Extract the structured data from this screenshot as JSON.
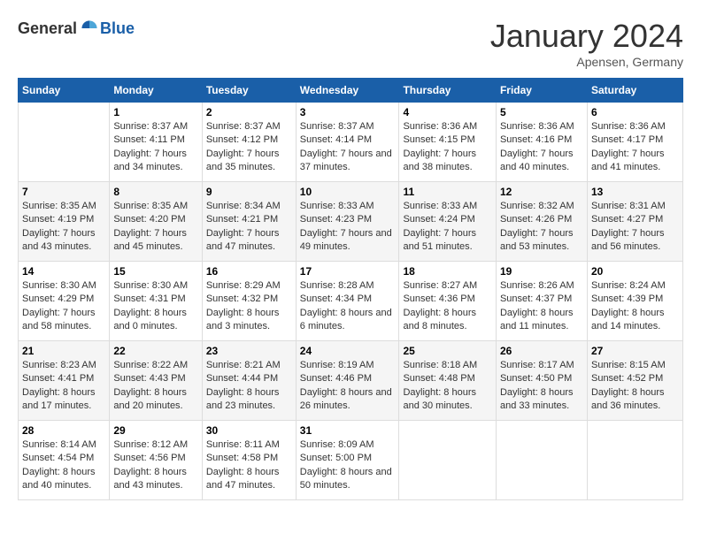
{
  "header": {
    "logo_general": "General",
    "logo_blue": "Blue",
    "month_title": "January 2024",
    "location": "Apensen, Germany"
  },
  "weekdays": [
    "Sunday",
    "Monday",
    "Tuesday",
    "Wednesday",
    "Thursday",
    "Friday",
    "Saturday"
  ],
  "weeks": [
    [
      {
        "day": "",
        "sunrise": "",
        "sunset": "",
        "daylight": ""
      },
      {
        "day": "1",
        "sunrise": "Sunrise: 8:37 AM",
        "sunset": "Sunset: 4:11 PM",
        "daylight": "Daylight: 7 hours and 34 minutes."
      },
      {
        "day": "2",
        "sunrise": "Sunrise: 8:37 AM",
        "sunset": "Sunset: 4:12 PM",
        "daylight": "Daylight: 7 hours and 35 minutes."
      },
      {
        "day": "3",
        "sunrise": "Sunrise: 8:37 AM",
        "sunset": "Sunset: 4:14 PM",
        "daylight": "Daylight: 7 hours and 37 minutes."
      },
      {
        "day": "4",
        "sunrise": "Sunrise: 8:36 AM",
        "sunset": "Sunset: 4:15 PM",
        "daylight": "Daylight: 7 hours and 38 minutes."
      },
      {
        "day": "5",
        "sunrise": "Sunrise: 8:36 AM",
        "sunset": "Sunset: 4:16 PM",
        "daylight": "Daylight: 7 hours and 40 minutes."
      },
      {
        "day": "6",
        "sunrise": "Sunrise: 8:36 AM",
        "sunset": "Sunset: 4:17 PM",
        "daylight": "Daylight: 7 hours and 41 minutes."
      }
    ],
    [
      {
        "day": "7",
        "sunrise": "Sunrise: 8:35 AM",
        "sunset": "Sunset: 4:19 PM",
        "daylight": "Daylight: 7 hours and 43 minutes."
      },
      {
        "day": "8",
        "sunrise": "Sunrise: 8:35 AM",
        "sunset": "Sunset: 4:20 PM",
        "daylight": "Daylight: 7 hours and 45 minutes."
      },
      {
        "day": "9",
        "sunrise": "Sunrise: 8:34 AM",
        "sunset": "Sunset: 4:21 PM",
        "daylight": "Daylight: 7 hours and 47 minutes."
      },
      {
        "day": "10",
        "sunrise": "Sunrise: 8:33 AM",
        "sunset": "Sunset: 4:23 PM",
        "daylight": "Daylight: 7 hours and 49 minutes."
      },
      {
        "day": "11",
        "sunrise": "Sunrise: 8:33 AM",
        "sunset": "Sunset: 4:24 PM",
        "daylight": "Daylight: 7 hours and 51 minutes."
      },
      {
        "day": "12",
        "sunrise": "Sunrise: 8:32 AM",
        "sunset": "Sunset: 4:26 PM",
        "daylight": "Daylight: 7 hours and 53 minutes."
      },
      {
        "day": "13",
        "sunrise": "Sunrise: 8:31 AM",
        "sunset": "Sunset: 4:27 PM",
        "daylight": "Daylight: 7 hours and 56 minutes."
      }
    ],
    [
      {
        "day": "14",
        "sunrise": "Sunrise: 8:30 AM",
        "sunset": "Sunset: 4:29 PM",
        "daylight": "Daylight: 7 hours and 58 minutes."
      },
      {
        "day": "15",
        "sunrise": "Sunrise: 8:30 AM",
        "sunset": "Sunset: 4:31 PM",
        "daylight": "Daylight: 8 hours and 0 minutes."
      },
      {
        "day": "16",
        "sunrise": "Sunrise: 8:29 AM",
        "sunset": "Sunset: 4:32 PM",
        "daylight": "Daylight: 8 hours and 3 minutes."
      },
      {
        "day": "17",
        "sunrise": "Sunrise: 8:28 AM",
        "sunset": "Sunset: 4:34 PM",
        "daylight": "Daylight: 8 hours and 6 minutes."
      },
      {
        "day": "18",
        "sunrise": "Sunrise: 8:27 AM",
        "sunset": "Sunset: 4:36 PM",
        "daylight": "Daylight: 8 hours and 8 minutes."
      },
      {
        "day": "19",
        "sunrise": "Sunrise: 8:26 AM",
        "sunset": "Sunset: 4:37 PM",
        "daylight": "Daylight: 8 hours and 11 minutes."
      },
      {
        "day": "20",
        "sunrise": "Sunrise: 8:24 AM",
        "sunset": "Sunset: 4:39 PM",
        "daylight": "Daylight: 8 hours and 14 minutes."
      }
    ],
    [
      {
        "day": "21",
        "sunrise": "Sunrise: 8:23 AM",
        "sunset": "Sunset: 4:41 PM",
        "daylight": "Daylight: 8 hours and 17 minutes."
      },
      {
        "day": "22",
        "sunrise": "Sunrise: 8:22 AM",
        "sunset": "Sunset: 4:43 PM",
        "daylight": "Daylight: 8 hours and 20 minutes."
      },
      {
        "day": "23",
        "sunrise": "Sunrise: 8:21 AM",
        "sunset": "Sunset: 4:44 PM",
        "daylight": "Daylight: 8 hours and 23 minutes."
      },
      {
        "day": "24",
        "sunrise": "Sunrise: 8:19 AM",
        "sunset": "Sunset: 4:46 PM",
        "daylight": "Daylight: 8 hours and 26 minutes."
      },
      {
        "day": "25",
        "sunrise": "Sunrise: 8:18 AM",
        "sunset": "Sunset: 4:48 PM",
        "daylight": "Daylight: 8 hours and 30 minutes."
      },
      {
        "day": "26",
        "sunrise": "Sunrise: 8:17 AM",
        "sunset": "Sunset: 4:50 PM",
        "daylight": "Daylight: 8 hours and 33 minutes."
      },
      {
        "day": "27",
        "sunrise": "Sunrise: 8:15 AM",
        "sunset": "Sunset: 4:52 PM",
        "daylight": "Daylight: 8 hours and 36 minutes."
      }
    ],
    [
      {
        "day": "28",
        "sunrise": "Sunrise: 8:14 AM",
        "sunset": "Sunset: 4:54 PM",
        "daylight": "Daylight: 8 hours and 40 minutes."
      },
      {
        "day": "29",
        "sunrise": "Sunrise: 8:12 AM",
        "sunset": "Sunset: 4:56 PM",
        "daylight": "Daylight: 8 hours and 43 minutes."
      },
      {
        "day": "30",
        "sunrise": "Sunrise: 8:11 AM",
        "sunset": "Sunset: 4:58 PM",
        "daylight": "Daylight: 8 hours and 47 minutes."
      },
      {
        "day": "31",
        "sunrise": "Sunrise: 8:09 AM",
        "sunset": "Sunset: 5:00 PM",
        "daylight": "Daylight: 8 hours and 50 minutes."
      },
      {
        "day": "",
        "sunrise": "",
        "sunset": "",
        "daylight": ""
      },
      {
        "day": "",
        "sunrise": "",
        "sunset": "",
        "daylight": ""
      },
      {
        "day": "",
        "sunrise": "",
        "sunset": "",
        "daylight": ""
      }
    ]
  ]
}
